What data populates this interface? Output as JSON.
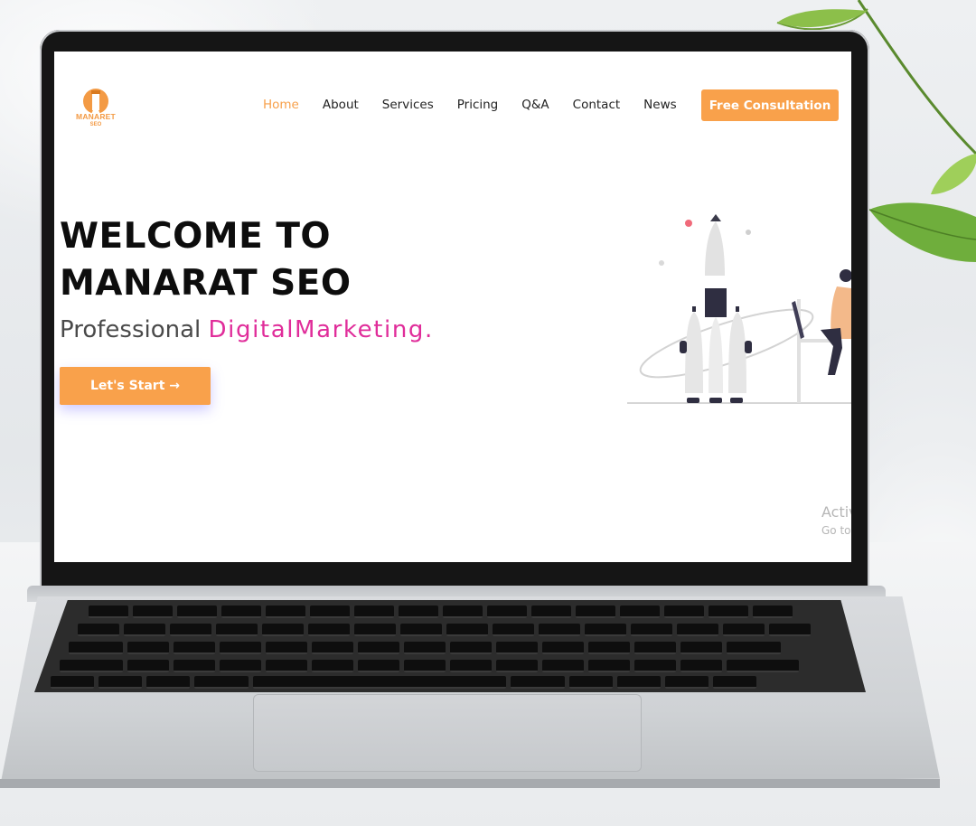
{
  "site": {
    "logo_text": "MANARET",
    "logo_sub": "SEO",
    "nav": [
      {
        "label": "Home",
        "active": true
      },
      {
        "label": "About"
      },
      {
        "label": "Services"
      },
      {
        "label": "Pricing"
      },
      {
        "label": "Q&A"
      },
      {
        "label": "Contact"
      },
      {
        "label": "News"
      }
    ],
    "cta_label": "Free Consultation",
    "hero": {
      "title_line1": "WELCOME TO",
      "title_line2": "MANARAT SEO",
      "subtitle_prefix": "Professional ",
      "subtitle_accent": "DigitalMarketing.",
      "button_label": "Let's Start →"
    },
    "watermark": {
      "line1": "Activ",
      "line2": "Go to"
    }
  },
  "colors": {
    "accent_orange": "#f9a14b",
    "accent_pink": "#e02d9a",
    "text_dark": "#0d0d0d"
  }
}
